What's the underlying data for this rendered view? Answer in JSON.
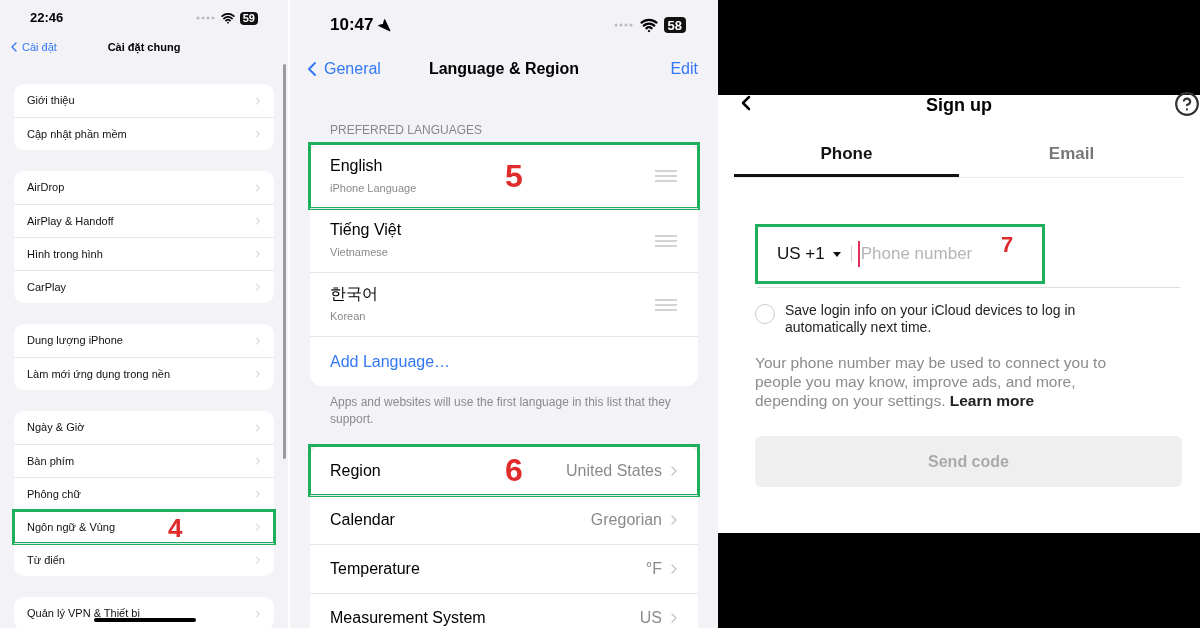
{
  "left": {
    "status": {
      "time": "22:46",
      "battery": "59"
    },
    "nav": {
      "back": "Cài đặt",
      "title": "Cài đặt chung"
    },
    "groups": [
      {
        "items": [
          {
            "label": "Giới thiệu",
            "highlighted": false
          },
          {
            "label": "Cập nhật phần mềm",
            "highlighted": false
          }
        ]
      },
      {
        "items": [
          {
            "label": "AirDrop",
            "highlighted": false
          },
          {
            "label": "AirPlay & Handoff",
            "highlighted": false
          },
          {
            "label": "Hình trong hình",
            "highlighted": false
          },
          {
            "label": "CarPlay",
            "highlighted": false
          }
        ]
      },
      {
        "items": [
          {
            "label": "Dung lượng iPhone",
            "highlighted": false
          },
          {
            "label": "Làm mới ứng dụng trong nền",
            "highlighted": false
          }
        ]
      },
      {
        "items": [
          {
            "label": "Ngày & Giờ",
            "highlighted": false
          },
          {
            "label": "Bàn phím",
            "highlighted": false
          },
          {
            "label": "Phông chữ",
            "highlighted": false
          },
          {
            "label": "Ngôn ngữ & Vùng",
            "highlighted": true,
            "step": "4"
          },
          {
            "label": "Từ điển",
            "highlighted": false
          }
        ]
      },
      {
        "items": [
          {
            "label": "Quản lý VPN & Thiết bị",
            "highlighted": false
          }
        ]
      }
    ]
  },
  "middle": {
    "status": {
      "time": "10:47",
      "battery": "58"
    },
    "nav": {
      "back": "General",
      "title": "Language & Region",
      "action": "Edit"
    },
    "section_header": "PREFERRED LANGUAGES",
    "languages": [
      {
        "name": "English",
        "subtitle": "iPhone Language",
        "highlighted": true,
        "step": "5"
      },
      {
        "name": "Tiếng Việt",
        "subtitle": "Vietnamese",
        "highlighted": false
      },
      {
        "name": "한국어",
        "subtitle": "Korean",
        "highlighted": false
      }
    ],
    "add_language": "Add Language…",
    "footer": "Apps and websites will use the first language in this list that they support.",
    "settings": [
      {
        "label": "Region",
        "value": "United States",
        "highlighted": true,
        "step": "6"
      },
      {
        "label": "Calendar",
        "value": "Gregorian",
        "highlighted": false
      },
      {
        "label": "Temperature",
        "value": "°F",
        "highlighted": false
      },
      {
        "label": "Measurement System",
        "value": "US",
        "highlighted": false
      }
    ]
  },
  "right": {
    "title": "Sign up",
    "tabs": [
      {
        "label": "Phone",
        "selected": true
      },
      {
        "label": "Email",
        "selected": false
      }
    ],
    "phone": {
      "country": "US +1",
      "placeholder": "Phone number",
      "highlighted": true,
      "step": "7"
    },
    "save_login": {
      "label": "Save login info on your iCloud devices to log in automatically next time.",
      "checked": false
    },
    "notice": "Your phone number may be used to connect you to people you may know, improve ads, and more, depending on your settings.",
    "learn_more": "Learn more",
    "button": {
      "label": "Send code",
      "disabled": true
    }
  }
}
